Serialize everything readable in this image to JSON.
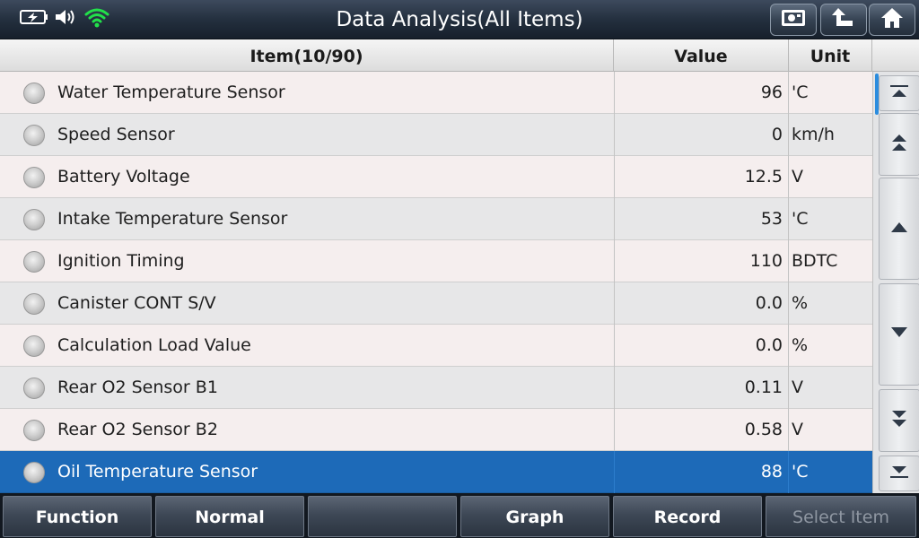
{
  "header": {
    "title": "Data Analysis(All Items)",
    "status_icons": [
      "battery-icon",
      "speaker-icon",
      "wifi-icon"
    ],
    "buttons": [
      "screenshot-icon",
      "back-icon",
      "home-icon"
    ]
  },
  "table": {
    "columns": {
      "item": "Item(10/90)",
      "value": "Value",
      "unit": "Unit"
    },
    "rows": [
      {
        "name": "Water Temperature Sensor",
        "value": "96",
        "unit": "'C"
      },
      {
        "name": "Speed Sensor",
        "value": "0",
        "unit": "km/h"
      },
      {
        "name": "Battery Voltage",
        "value": "12.5",
        "unit": "V"
      },
      {
        "name": "Intake Temperature Sensor",
        "value": "53",
        "unit": "'C"
      },
      {
        "name": "Ignition Timing",
        "value": "110",
        "unit": "BDTC"
      },
      {
        "name": "Canister CONT S/V",
        "value": "0.0",
        "unit": "%"
      },
      {
        "name": "Calculation Load Value",
        "value": "0.0",
        "unit": "%"
      },
      {
        "name": "Rear O2 Sensor B1",
        "value": "0.11",
        "unit": "V"
      },
      {
        "name": "Rear O2 Sensor B2",
        "value": "0.58",
        "unit": "V"
      },
      {
        "name": "Oil Temperature Sensor",
        "value": "88",
        "unit": "'C"
      }
    ],
    "selected_index": 9
  },
  "bottom": {
    "function": "Function",
    "normal": "Normal",
    "empty": "",
    "graph": "Graph",
    "record": "Record",
    "select_item": "Select Item"
  },
  "colors": {
    "selected_row": "#1d6ab8",
    "row_odd": "#f5eeee",
    "row_even": "#e7e7e8",
    "wifi": "#22e04a",
    "scroll_indicator": "#2b8cde"
  }
}
